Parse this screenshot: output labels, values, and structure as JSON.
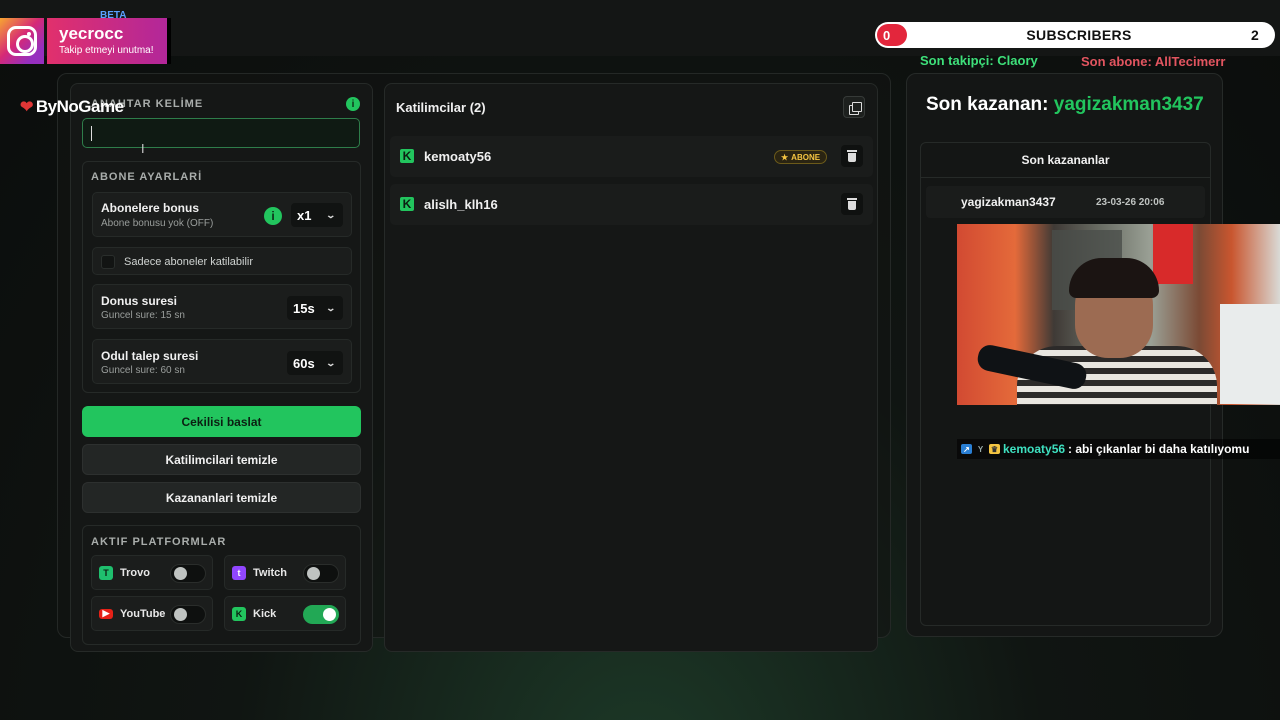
{
  "topbar": {
    "beta": "BETA"
  },
  "instagram": {
    "username": "yecrocc",
    "tagline": "Takip etmeyi unutma!",
    "gradient_from": "#f7a531",
    "gradient_to": "#962fbf"
  },
  "subs": {
    "current": "0",
    "label": "SUBSCRIBERS",
    "goal": "2"
  },
  "alerts": {
    "last_follower": "Son takipçi: Claory",
    "last_sub": "Son abone: AllTecimerr"
  },
  "logo": {
    "text": "ByNoGame"
  },
  "keyword": {
    "title": "ANAHTAR KELİME",
    "value": ""
  },
  "sub_settings": {
    "title": "ABONE AYARLARİ",
    "bonus": {
      "label": "Abonelere bonus",
      "sub": "Abone bonusu yok (OFF)",
      "value": "x1"
    },
    "only_subs": {
      "label": "Sadece aboneler katilabilir"
    },
    "spin": {
      "label": "Donus suresi",
      "sub": "Guncel sure: 15 sn",
      "value": "15s"
    },
    "claim": {
      "label": "Odul talep suresi",
      "sub": "Guncel sure: 60 sn",
      "value": "60s"
    }
  },
  "buttons": {
    "start": "Cekilisi baslat",
    "clear_participants": "Katilimcilari temizle",
    "clear_winners": "Kazananlari temizle"
  },
  "platforms": {
    "title": "AKTIF PLATFORMLAR",
    "items": [
      {
        "name": "Trovo",
        "on": false
      },
      {
        "name": "Twitch",
        "on": false
      },
      {
        "name": "YouTube",
        "on": false
      },
      {
        "name": "Kick",
        "on": true
      }
    ]
  },
  "participants": {
    "title": "Katilimcilar (2)",
    "list": [
      {
        "name": "kemoaty56",
        "badge": "ABONE"
      },
      {
        "name": "alislh_klh16"
      }
    ]
  },
  "winner": {
    "label": "Son kazanan:",
    "name": "yagizakman3437",
    "list_title": "Son kazananlar",
    "list": [
      {
        "name": "yagizakman3437",
        "date": "23-03-26 20:06"
      }
    ]
  },
  "chat": {
    "user": "kemoaty56",
    "message": ": abi çıkanlar bi daha katılıyomu"
  },
  "colors": {
    "accent": "#22c55e",
    "danger": "#e3263c",
    "sub_alert": "#e25560"
  }
}
